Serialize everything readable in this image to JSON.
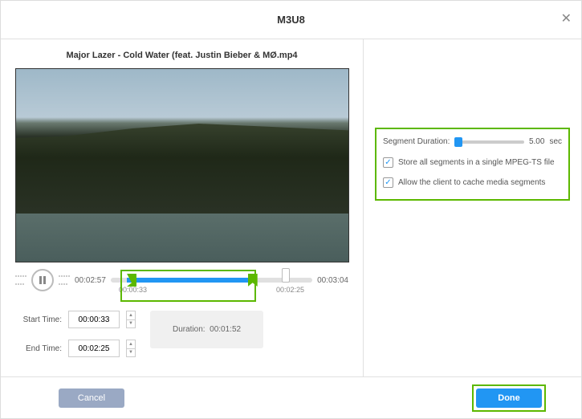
{
  "header": {
    "title": "M3U8"
  },
  "video": {
    "title": "Major Lazer - Cold Water (feat. Justin Bieber & MØ.mp4"
  },
  "playback": {
    "current_time": "00:02:57",
    "total_time": "00:03:04",
    "range_start": "00:00:33",
    "range_end": "00:02:25"
  },
  "time_fields": {
    "start_label": "Start Time:",
    "start_value": "00:00:33",
    "end_label": "End Time:",
    "end_value": "00:02:25"
  },
  "duration": {
    "label": "Duration:",
    "value": "00:01:52"
  },
  "settings": {
    "segment_label": "Segment Duration:",
    "segment_value": "5.00",
    "segment_unit": "sec",
    "opt1": "Store all segments in a single MPEG-TS file",
    "opt2": "Allow the client to cache media segments"
  },
  "buttons": {
    "cancel": "Cancel",
    "done": "Done"
  }
}
